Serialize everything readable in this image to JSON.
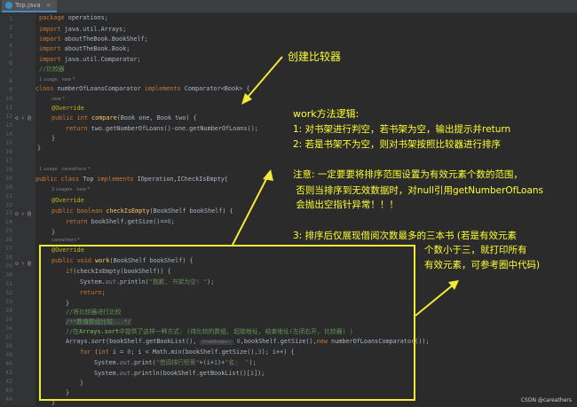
{
  "tab": {
    "label": "Top.java"
  },
  "gutter": {
    "lines": [
      "1",
      "2",
      "3",
      "4",
      "5",
      "6",
      "7",
      "8",
      "9",
      "10",
      "11",
      "12",
      "13",
      "14",
      "15",
      "16",
      "17",
      "18",
      "19",
      "20",
      "21",
      "22",
      "23",
      "24",
      "25",
      "26",
      "27",
      "28",
      "29",
      "30",
      "31",
      "32",
      "33",
      "34",
      "35",
      "36",
      "37",
      "38",
      "39",
      "40",
      "41",
      "42",
      "43",
      "44"
    ]
  },
  "hints": {
    "h1": "1 usage   new *",
    "h2": "new *",
    "h3": "1 usage   careathers *",
    "h4": "3 usages   new *",
    "h5": "careathers *"
  },
  "code": {
    "l1_a": "package",
    "l1_b": " operations;",
    "l3_a": "import",
    "l3_b": " java.util.Arrays;",
    "l4_a": "import",
    "l4_b": " aboutTheBook.BookShelf;",
    "l5_a": "import",
    "l5_b": " aboutTheBook.Book;",
    "l6_a": "import",
    "l6_b": " java.util.Comparator;",
    "l7": "//比较器",
    "l8_a": "class",
    "l8_b": " numberOfLoansComparator ",
    "l8_c": "implements",
    "l8_d": " Comparator<Book> {",
    "l9": "@Override",
    "l10_a": "public int ",
    "l10_b": "compare",
    "l10_c": "(Book one, Book two) {",
    "l11_a": "return",
    "l11_b": " two.getNumberOfLoans()-one.getNumberOfLoans();",
    "l12": "}",
    "l13": "}",
    "l15_a": "public class",
    "l15_b": " Top ",
    "l15_c": "implements",
    "l15_d": " IOperation,ICheckIsEmpty{",
    "l16": "@Override",
    "l17_a": "public boolean ",
    "l17_b": "checkIsEmpty",
    "l17_c": "(BookShelf bookShelf) {",
    "l18_a": "return",
    "l18_b": " bookShelf.getSize()==",
    "l18_c": "0",
    "l18_d": ";",
    "l19": "}",
    "l21": "@Override",
    "l22_a": "public void ",
    "l22_b": "work",
    "l22_c": "(BookShelf bookShelf) {",
    "l23_a": "if",
    "l23_b": "(checkIsEmpty(bookShelf)) {",
    "l24_a": "System.",
    "l24_b": "out",
    "l24_c": ".println(",
    "l24_d": "\"抱歉, 书架为空! \"",
    "l24_e": ");",
    "l25_a": "return",
    "l25_b": ";",
    "l26": "}",
    "l27": "//将比较器进行比较",
    "l28": "/**数值数组比较...*/",
    "l29_a": "//在",
    "l29_b": "Arrays.sort",
    "l29_c": "中提供了这样一种方式: (待比较的数组, 起始地址, 结束地址(左闭右开, 比较器) )",
    "l30_a": "Arrays.",
    "l30_b": "sort",
    "l30_c": "(bookShelf.getBookList(), ",
    "l30_inlay": "fromIndex:",
    "l30_d": " 0",
    "l30_e": ",bookShelf.getSize(),",
    "l30_f": "new",
    "l30_g": " numberOfLoansComparator());",
    "l31_a": "for",
    "l31_b": " (",
    "l31_c": "int",
    "l31_d": " i = ",
    "l31_e": "0",
    "l31_f": "; i < Math.",
    "l31_g": "min",
    "l31_h": "(bookShelf.getSize(),",
    "l31_i": "3",
    "l31_j": "); i++) {",
    "l32_a": "System.",
    "l32_b": "out",
    "l32_c": ".print(",
    "l32_d": "\"借阅排行榜第\"",
    "l32_e": "+(i+",
    "l32_f": "1",
    "l32_g": ")+",
    "l32_h": "\"名:  \"",
    "l32_i": ");",
    "l33_a": "System.",
    "l33_b": "out",
    "l33_c": ".println(bookShelf.getBookList()[i]);",
    "l34": "}",
    "l35": "}",
    "l36": "}"
  },
  "annotations": {
    "arrow_label": "创建比较器",
    "logic_title": "work方法逻辑:",
    "logic_1": "1: 对书架进行判空，若书架为空，输出提示并return",
    "logic_2": "2: 若是书架不为空，则对书架按照比较器进行排序",
    "note_1": "注意: 一定要要将排序范围设置为有效元素个数的范围，",
    "note_2": " 否则当排序到无效数据时，对null引用getNumberOfLoans",
    "note_3": " 会抛出空指针异常！！！",
    "step3_1": "3: 排序后仅展现借阅次数最多的三本书 (若是有效元素",
    "step3_2": "个数小于三，就打印所有",
    "step3_3": "有效元素，可参考圈中代码)"
  },
  "watermark": "CSDN @careathers",
  "colors": {
    "annotation": "#ffff33",
    "box": "#f2ea36",
    "background": "#2b2b2b"
  }
}
